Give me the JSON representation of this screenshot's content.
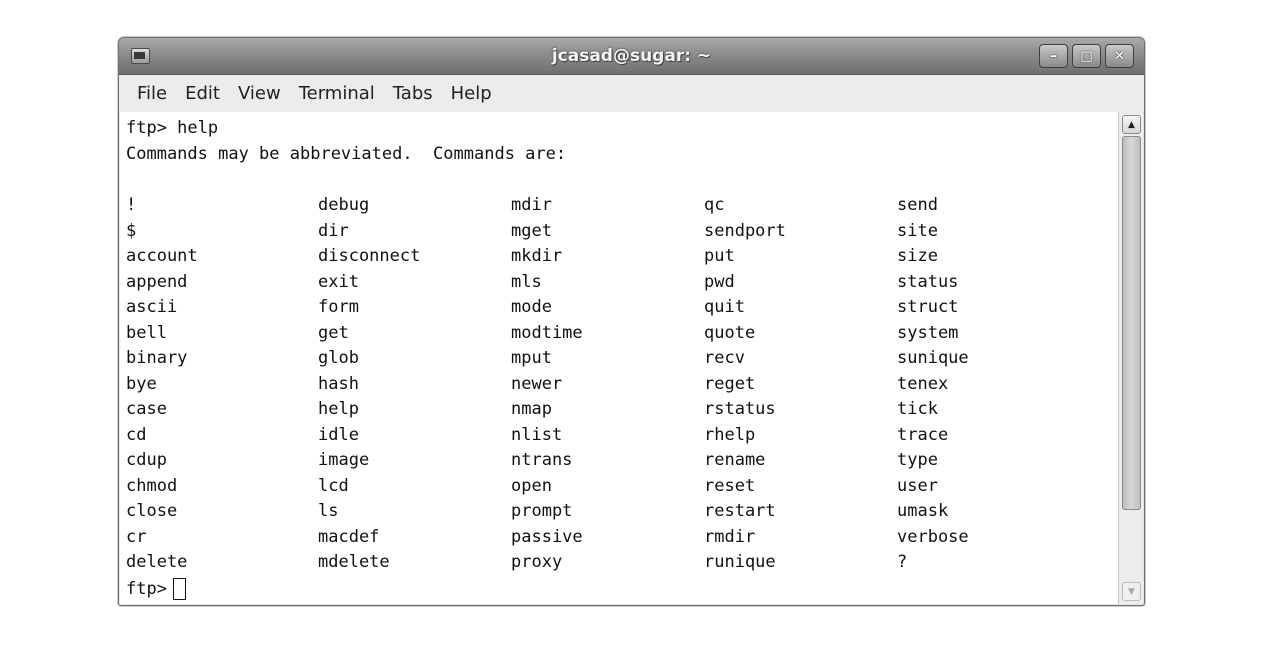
{
  "window": {
    "title": "jcasad@sugar: ~",
    "controls": [
      "–",
      "□",
      "✕"
    ]
  },
  "menubar": {
    "items": [
      "File",
      "Edit",
      "View",
      "Terminal",
      "Tabs",
      "Help"
    ]
  },
  "terminal": {
    "line1": "ftp> help",
    "line2": "Commands may be abbreviated.  Commands are:",
    "columns": [
      [
        "!",
        "$",
        "account",
        "append",
        "ascii",
        "bell",
        "binary",
        "bye",
        "case",
        "cd",
        "cdup",
        "chmod",
        "close",
        "cr",
        "delete"
      ],
      [
        "debug",
        "dir",
        "disconnect",
        "exit",
        "form",
        "get",
        "glob",
        "hash",
        "help",
        "idle",
        "image",
        "lcd",
        "ls",
        "macdef",
        "mdelete"
      ],
      [
        "mdir",
        "mget",
        "mkdir",
        "mls",
        "mode",
        "modtime",
        "mput",
        "newer",
        "nmap",
        "nlist",
        "ntrans",
        "open",
        "prompt",
        "passive",
        "proxy"
      ],
      [
        "qc",
        "sendport",
        "put",
        "pwd",
        "quit",
        "quote",
        "recv",
        "reget",
        "rstatus",
        "rhelp",
        "rename",
        "reset",
        "restart",
        "rmdir",
        "runique"
      ],
      [
        "send",
        "site",
        "size",
        "status",
        "struct",
        "system",
        "sunique",
        "tenex",
        "tick",
        "trace",
        "type",
        "user",
        "umask",
        "verbose",
        "?"
      ]
    ],
    "prompt": "ftp>"
  }
}
